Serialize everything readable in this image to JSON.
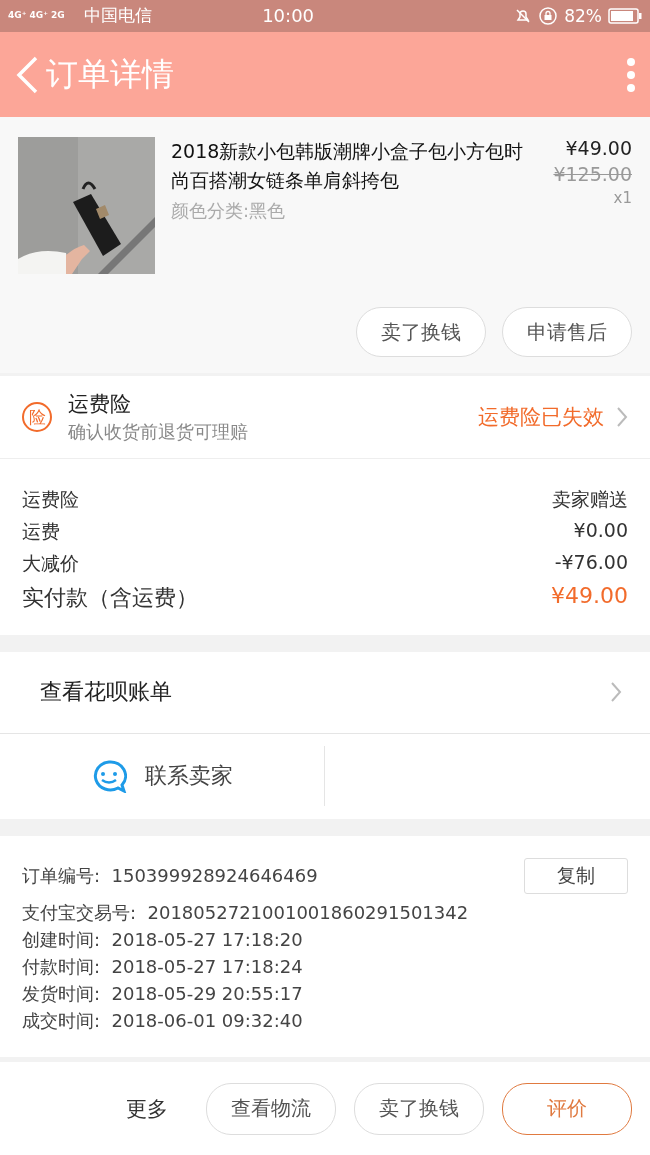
{
  "status_bar": {
    "network": "4G⁺ 4G⁺ 2G",
    "carrier": "中国电信",
    "time": "10:00",
    "battery": "82%"
  },
  "header": {
    "title": "订单详情"
  },
  "product": {
    "title": "2018新款小包韩版潮牌小盒子包小方包时尚百搭潮女链条单肩斜挎包",
    "sku": "颜色分类:黑色",
    "price": "¥49.00",
    "original_price": "¥125.00",
    "quantity": "x1",
    "actions": [
      "卖了换钱",
      "申请售后"
    ]
  },
  "insurance": {
    "badge": "险",
    "title": "运费险",
    "subtitle": "确认收货前退货可理赔",
    "status": "运费险已失效"
  },
  "summary": [
    {
      "label": "运费险",
      "value": "卖家赠送",
      "kind": "normal"
    },
    {
      "label": "运费",
      "value": "¥0.00",
      "kind": "normal"
    },
    {
      "label": "大减价",
      "value": "-¥76.00",
      "kind": "normal"
    },
    {
      "label": "实付款（含运费）",
      "value": "¥49.00",
      "kind": "total"
    }
  ],
  "huabei": {
    "label": "查看花呗账单"
  },
  "contact": {
    "label": "联系卖家"
  },
  "order_info": {
    "copy_button": "复制",
    "lines": [
      {
        "label": "订单编号:",
        "value": "150399928924646469"
      },
      {
        "label": "支付宝交易号:",
        "value": "2018052721001001860291501342"
      },
      {
        "label": "创建时间:",
        "value": "2018-05-27 17:18:20"
      },
      {
        "label": "付款时间:",
        "value": "2018-05-27 17:18:24"
      },
      {
        "label": "发货时间:",
        "value": "2018-05-29 20:55:17"
      },
      {
        "label": "成交时间:",
        "value": "2018-06-01 09:32:40"
      }
    ]
  },
  "bottom_bar": {
    "more": "更多",
    "buttons": [
      {
        "label": "查看物流",
        "kind": "normal"
      },
      {
        "label": "卖了换钱",
        "kind": "normal"
      },
      {
        "label": "评价",
        "kind": "primary"
      }
    ]
  }
}
